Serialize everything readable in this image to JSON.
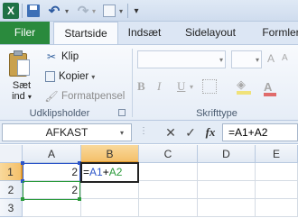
{
  "quick_access": {
    "app_icon": "excel-logo",
    "app_letter": "X",
    "icons": [
      "save-icon",
      "undo-icon",
      "redo-icon",
      "print-preview-icon",
      "customize-icon"
    ]
  },
  "tabs": [
    {
      "label": "Filer"
    },
    {
      "label": "Startside"
    },
    {
      "label": "Indsæt"
    },
    {
      "label": "Sidelayout"
    },
    {
      "label": "Formler"
    }
  ],
  "clipboard": {
    "paste_line1": "Sæt",
    "paste_line2": "ind",
    "paste_dd": "▾",
    "cut": "Klip",
    "copy": "Kopier",
    "copy_dd": "▾",
    "format_painter": "Formatpensel",
    "group_label": "Udklipsholder"
  },
  "font_group": {
    "group_label": "Skrifttype",
    "bold": "B",
    "italic": "I",
    "underline": "U",
    "color_letter": "A"
  },
  "formula_bar": {
    "name_box": "AFKAST",
    "formula": "=A1+A2",
    "cancel": "✕",
    "enter": "✓",
    "fx": "fx"
  },
  "sheet": {
    "columns": [
      "A",
      "B",
      "C",
      "D",
      "E"
    ],
    "rows": [
      "1",
      "2",
      "3"
    ],
    "cells": {
      "A1": "2",
      "A2": "2"
    },
    "edit": {
      "eq": "=",
      "ref1": "A1",
      "op": "+",
      "ref2": "A2"
    },
    "colors": {
      "ref1": "#2c55c9",
      "ref2": "#2a9a3a",
      "selected_header": "#f4c06a"
    }
  }
}
